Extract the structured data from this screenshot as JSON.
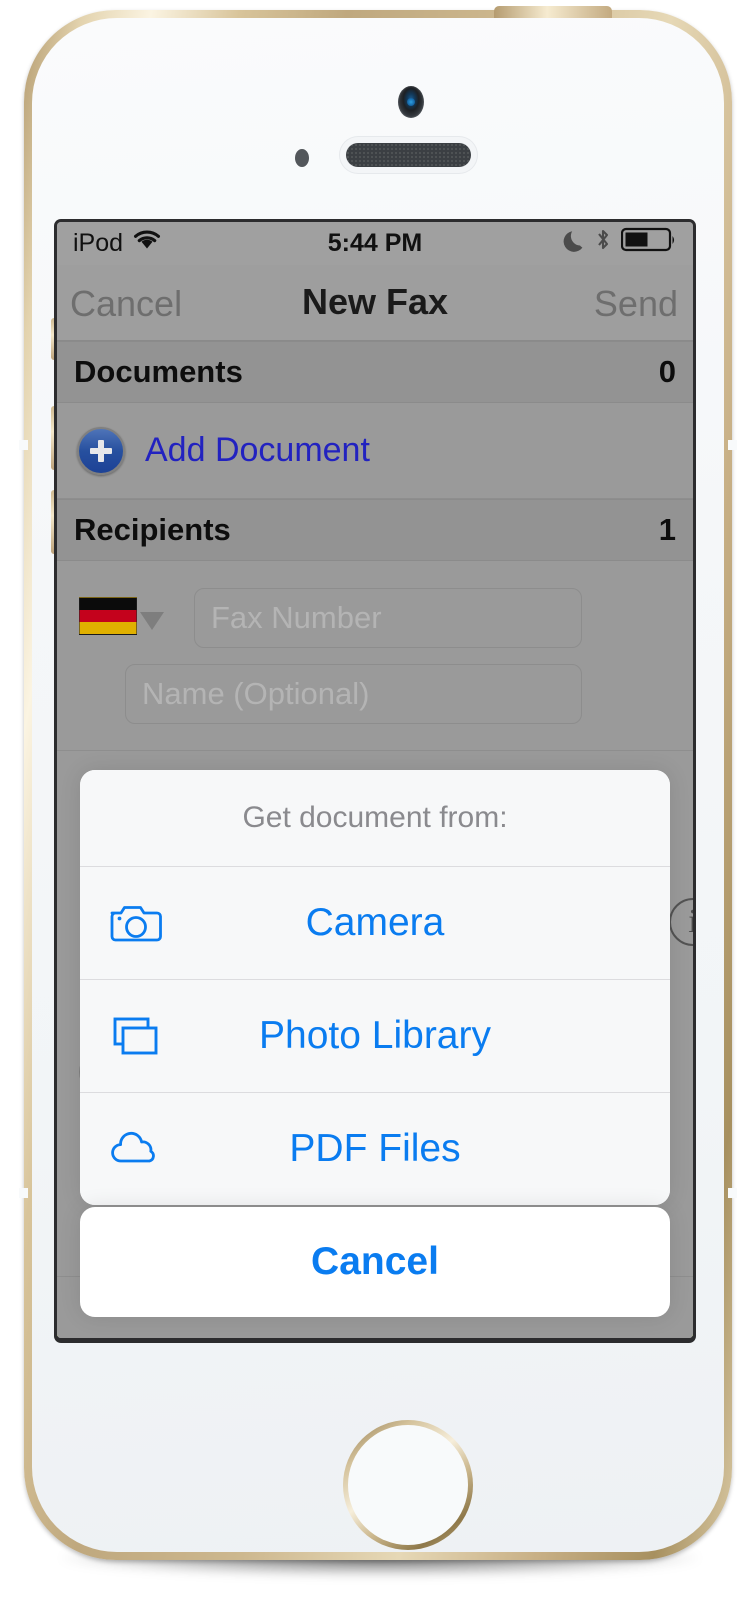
{
  "device": {
    "model_name": "iphone-5s-gold"
  },
  "status_bar": {
    "carrier": "iPod",
    "wifi_icon": "wifi-icon",
    "time": "5:44 PM",
    "dnd_icon": "moon-icon",
    "bluetooth_icon": "bluetooth-icon",
    "battery_icon": "battery-icon",
    "battery_level_percent": 50
  },
  "nav_bar": {
    "left_button": "Cancel",
    "title": "New Fax",
    "right_button": "Send"
  },
  "sections": {
    "documents": {
      "header": "Documents",
      "count": "0",
      "add_row_label": "Add Document",
      "add_row_icon": "plus-circle-icon"
    },
    "recipients": {
      "header": "Recipients",
      "count": "1",
      "country_flag": "flag-germany-icon",
      "country_caret": "chevron-down-icon",
      "fax_number_value": "",
      "fax_number_placeholder": "Fax Number",
      "name_value": "",
      "name_placeholder": "Name (Optional)",
      "info_icon": "info-circle-icon",
      "add_recipient_icon": "plus-circle-icon"
    }
  },
  "action_sheet": {
    "title": "Get document from:",
    "options": [
      {
        "label": "Camera",
        "icon": "camera-icon"
      },
      {
        "label": "Photo Library",
        "icon": "photo-stack-icon"
      },
      {
        "label": "PDF Files",
        "icon": "cloud-icon"
      }
    ],
    "cancel_label": "Cancel"
  },
  "colors": {
    "tint_blue": "#0a7cf0",
    "link_blue": "#2222c0",
    "sheet_bg": "#f7f8f9",
    "dim_overlay": "#9a9a9a"
  }
}
